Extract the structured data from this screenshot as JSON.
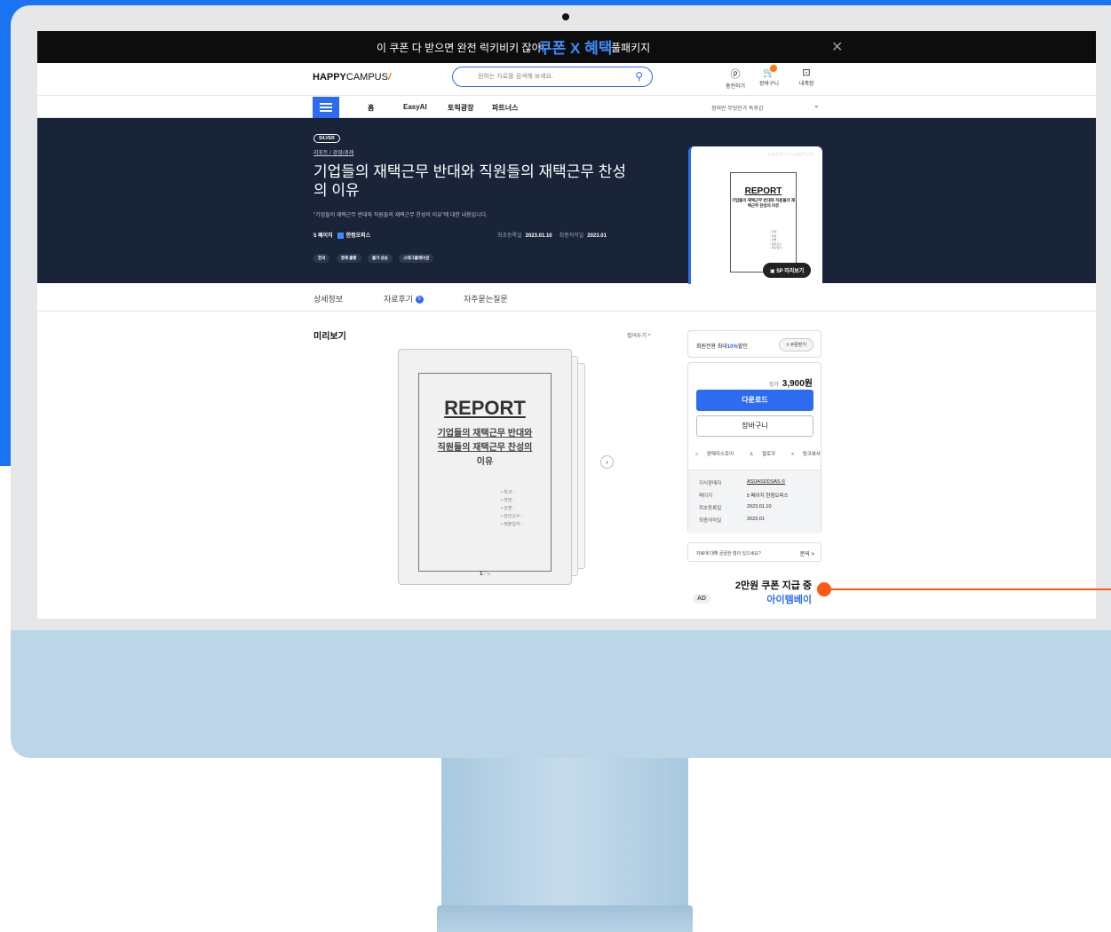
{
  "banner": {
    "text": "이 쿠폰 다 받으면 완전 럭키비키 잖아!",
    "highlight": "쿠폰 X 혜택",
    "text2": "풀패키지",
    "close": "✕"
  },
  "header": {
    "logo_bold": "HAPPY",
    "logo_thin": "CAMPUS",
    "logo_mark": "/",
    "search_placeholder": "원하는 자료를 검색해 보세요.",
    "icons": [
      {
        "glyph": "ⓟ",
        "label": "충전하기"
      },
      {
        "glyph": "🛒",
        "label": "장바구니"
      },
      {
        "glyph": "⊡",
        "label": "내계정"
      }
    ]
  },
  "nav": {
    "items": [
      "홈",
      "EasyAI",
      "토픽광장",
      "파트너스"
    ],
    "right_text": "정의란 무엇인가 독후감"
  },
  "hero": {
    "badge": "SILVER",
    "breadcrumb": "리포트 / 경영/경제",
    "title": "기업들의 재택근무 반대와 직원들의 재택근무 찬성의 이유",
    "description": "\"기업들의 재택근무 반대와 직원들의 재택근무 찬성의 이유\"에 대한 내용입니다.",
    "pages": "5 페이지",
    "format": "한컴오피스",
    "reg_label": "최초등록일",
    "reg_date": "2023.01.10",
    "mod_label": "최종저작일",
    "mod_date": "2023.01",
    "tags": [
      "한국",
      "경제 불황",
      "물가 상승",
      "스태그플레이션"
    ],
    "card_watermark": "HAPPYCAMPUS",
    "card_doc_title": "REPORT",
    "card_doc_subtitle": "기업들의 재택근무 반대와 직원들의 재택근무 찬성의 이유",
    "card_doc_list": "• 학과 :\n• 학번 :\n• 성명 :\n• 담당교수 :\n• 제출일자 :",
    "preview_button": "5P 미리보기"
  },
  "tabs": {
    "detail": "상세정보",
    "review": "자료후기",
    "review_count": "0",
    "faq": "자주묻는질문"
  },
  "preview": {
    "title": "미리보기",
    "fold": "접어두기 ^",
    "doc_title": "REPORT",
    "doc_subtitle_1": "기업들의 재택근무 반대와",
    "doc_subtitle_2": "직원들의 재택근무 찬성의",
    "doc_subtitle_3": "이유",
    "doc_list": "• 학과 :\n• 학번 :\n• 성명 :\n• 담당교수 :\n• 제출일자 :",
    "page_current": "1",
    "page_total": "/ 5",
    "next": "›"
  },
  "sidebar": {
    "coupon_text_a": "회원전용 최대",
    "coupon_text_b": "10%",
    "coupon_text_c": "할인",
    "coupon_button": "± 쿠폰받기",
    "price_label": "정가",
    "price": "3,900원",
    "download": "다운로드",
    "cart": "장바구니",
    "actions": [
      "판매자스토어",
      "팔로우",
      "링크복사"
    ],
    "info": [
      {
        "label": "지식판매자",
        "value": "ASDASDDSAS ©"
      },
      {
        "label": "페이지",
        "value": "5 페이지  한컴오피스"
      },
      {
        "label": "최초등록일",
        "value": "2023.01.10"
      },
      {
        "label": "최종저작일",
        "value": "2023.01"
      }
    ],
    "question": "자료에 대해 궁금한 점이 있으세요?",
    "question_link": "문의 >",
    "ad_tag": "AD",
    "ad_line1": "2만원 쿠폰 지급 중",
    "ad_line2": "아이템베이"
  },
  "colors": {
    "accent": "#2d6cf0",
    "hero_bg": "#192438",
    "pointer": "#ff5a12"
  }
}
